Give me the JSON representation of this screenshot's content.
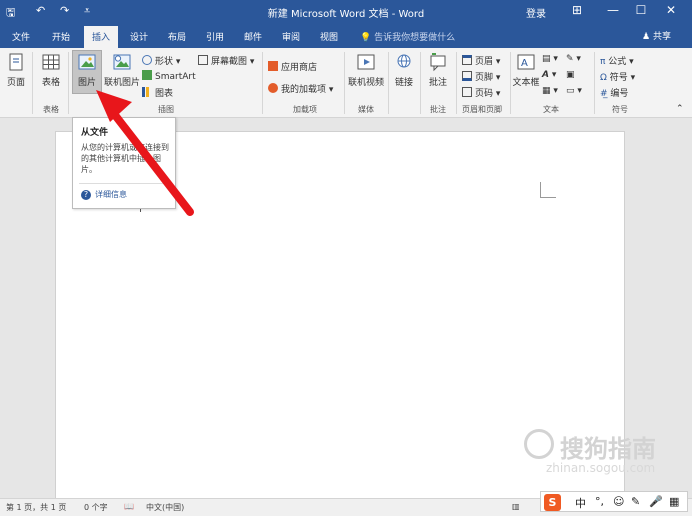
{
  "titlebar": {
    "title": "新建 Microsoft Word 文档 - Word",
    "login": "登录",
    "save_icon": "save-icon",
    "undo_icon": "undo-icon",
    "redo_icon": "redo-icon",
    "bg_color": "#2b579a"
  },
  "tabs": {
    "file": "文件",
    "home": "开始",
    "insert": "插入",
    "design": "设计",
    "layout": "布局",
    "references": "引用",
    "mailings": "邮件",
    "review": "审阅",
    "view": "视图",
    "tell_me": "告诉我你想要做什么",
    "share": "共享"
  },
  "ribbon": {
    "pages": {
      "label": "页面"
    },
    "table": {
      "label": "表格",
      "group": "表格"
    },
    "illustrations": {
      "picture": "图片",
      "online_picture": "联机图片",
      "shapes": "形状",
      "smartart": "SmartArt",
      "chart": "图表",
      "screenshot": "屏幕截图",
      "group": "插图"
    },
    "addins": {
      "store": "应用商店",
      "my_addins": "我的加载项",
      "group": "加载项"
    },
    "media": {
      "online_video": "联机视频",
      "group": "媒体"
    },
    "links": {
      "label": "链接"
    },
    "comments": {
      "label": "批注",
      "group": "批注"
    },
    "header_footer": {
      "header": "页眉",
      "footer": "页脚",
      "page_number": "页码",
      "group": "页眉和页脚"
    },
    "text": {
      "textbox": "文本框",
      "group": "文本"
    },
    "symbols": {
      "equation": "公式",
      "symbol": "符号",
      "number": "编号",
      "group": "符号"
    }
  },
  "tooltip": {
    "title": "从文件",
    "body": "从您的计算机或您连接到的其他计算机中插入图片。",
    "more": "详细信息"
  },
  "statusbar": {
    "page": "第 1 页，共 1 页",
    "words": "0 个字",
    "language": "中文(中国)"
  },
  "ime": {
    "logo": "S",
    "lang": "中",
    "punct": "°,",
    "emoji": "☺",
    "pen": "✎",
    "mic": "🎤",
    "grid": "▦"
  },
  "watermark": {
    "text": "搜狗指南",
    "url": "zhinan.sogou.com"
  },
  "colors": {
    "accent": "#2b579a",
    "arrow": "#e8161b",
    "ribbon_bg": "#f3f3f3",
    "doc_bg": "#e6e6e6"
  }
}
